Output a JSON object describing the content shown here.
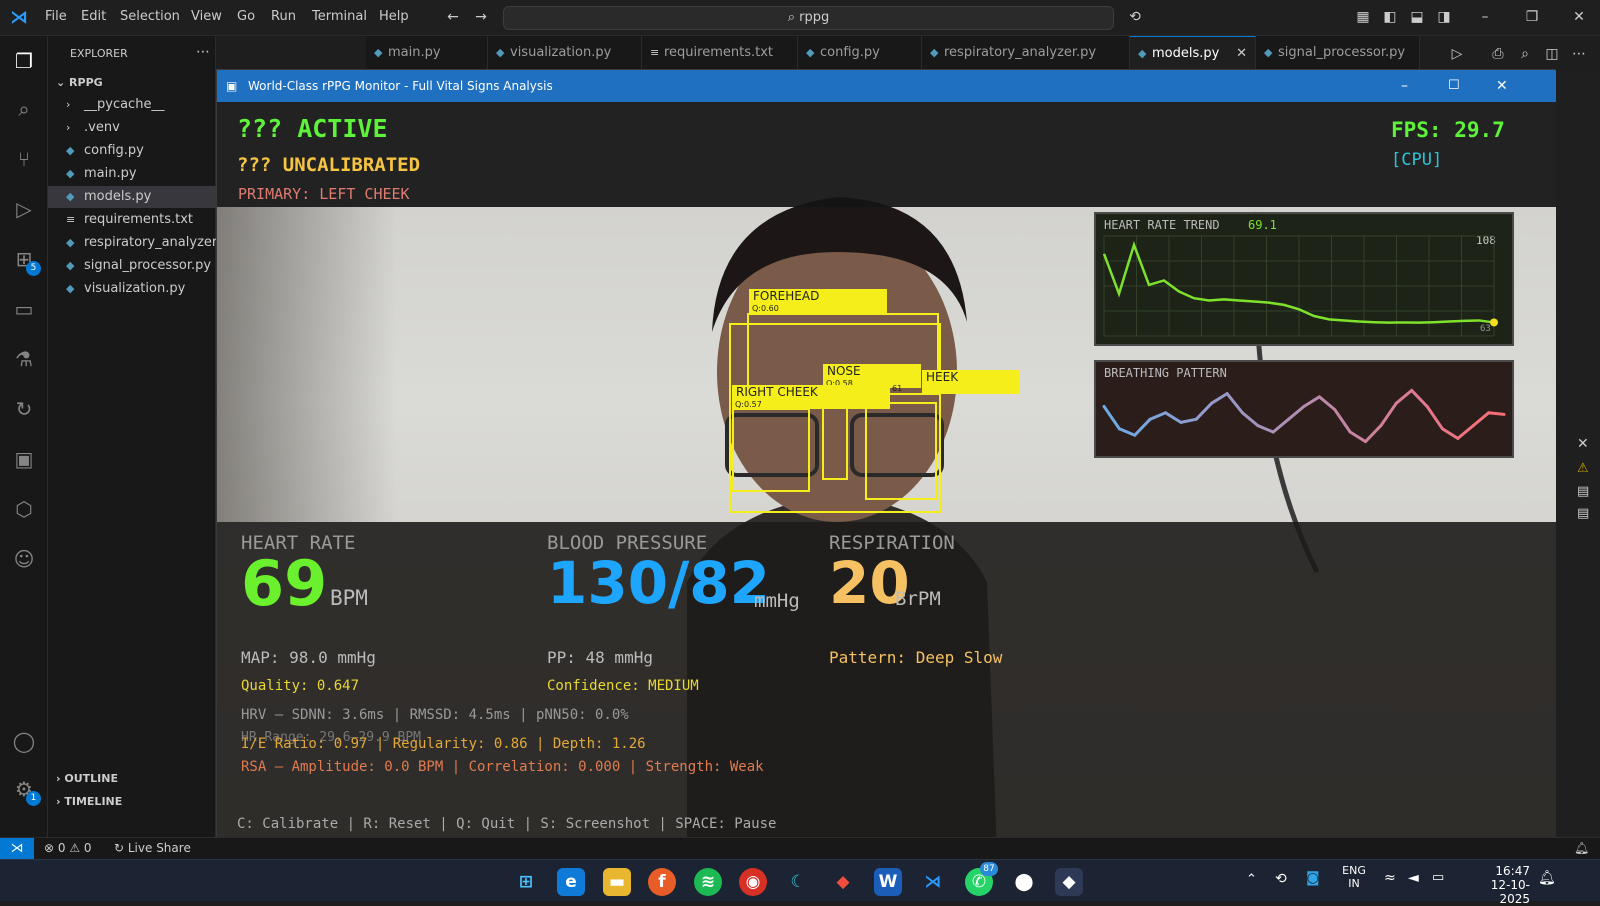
{
  "vscode": {
    "menu": [
      "File",
      "Edit",
      "Selection",
      "View",
      "Go",
      "Run",
      "Terminal",
      "Help"
    ],
    "search": "rppg",
    "explorer_title": "EXPLORER",
    "project": "RPPG",
    "files": [
      "__pycache__",
      ".venv",
      "config.py",
      "main.py",
      "models.py",
      "requirements.txt",
      "respiratory_analyzer.py",
      "signal_processor.py",
      "visualization.py"
    ],
    "tabs": [
      "main.py",
      "visualization.py",
      "requirements.txt",
      "config.py",
      "respiratory_analyzer.py",
      "models.py",
      "signal_processor.py"
    ],
    "active_tab": "models.py",
    "outline": "OUTLINE",
    "timeline": "TIMELINE",
    "status": {
      "errors": "0",
      "warnings": "0",
      "live_share": "Live Share"
    },
    "badges": {
      "extensions": "5",
      "settings": "1"
    }
  },
  "app": {
    "window_title": "World-Class rPPG Monitor - Full Vital Signs Analysis",
    "status_active": "??? ACTIVE",
    "status_calib": "??? UNCALIBRATED",
    "primary": "PRIMARY: LEFT CHEEK",
    "fps": "FPS: 29.7",
    "device": "[CPU]",
    "roi": {
      "forehead": "FOREHEAD",
      "forehead_q": "Q:0.60",
      "nose": "NOSE",
      "nose_q": "Q:0.58",
      "left_cheek": "HEEK",
      "left_q": "61",
      "right_cheek": "RIGHT CHEEK",
      "right_q": "Q:0.57"
    },
    "hr_trend": {
      "title": "HEART RATE TREND",
      "value": "69.1",
      "max": "108",
      "min": "63",
      "color": "#7ee22d"
    },
    "breathing": {
      "title": "BREATHING PATTERN"
    },
    "heart_rate": {
      "label": "HEART RATE",
      "value": "69",
      "unit": "BPM",
      "color": "#6bf02e"
    },
    "blood_pressure": {
      "label": "BLOOD PRESSURE",
      "value": "130/82",
      "unit": "mmHg",
      "color": "#1ea6ff"
    },
    "respiration": {
      "label": "RESPIRATION",
      "value": "20",
      "unit": "BrPM",
      "color": "#f5c163"
    },
    "map": "MAP: 98.0 mmHg",
    "pp": "PP: 48 mmHg",
    "pattern": "Pattern: Deep Slow",
    "quality": "Quality: 0.647",
    "confidence": "Confidence: MEDIUM",
    "hrv": "HRV — SDNN: 3.6ms | RMSSD: 4.5ms | pNN50: 0.0%",
    "hr_range": "HR Range: 29.6–29.9 BPM",
    "ie": "I/E Ratio: 0.97 | Regularity: 0.86 | Depth: 1.26",
    "rsa": "RSA — Amplitude: 0.0 BPM | Correlation: 0.000 | Strength: Weak",
    "controls": "C: Calibrate | R: Reset | Q: Quit | S: Screenshot | SPACE: Pause"
  },
  "chart_data": [
    {
      "type": "line",
      "title": "HEART RATE TREND",
      "ylim": [
        63,
        108
      ],
      "series": [
        {
          "values": [
            100,
            82,
            104,
            86,
            88,
            83,
            80,
            79,
            79.5,
            79,
            78.5,
            78,
            77,
            75,
            72,
            70.5,
            70,
            69.5,
            69.2,
            69,
            69.1,
            69,
            69.2,
            69.5,
            69.8,
            70,
            69.1
          ]
        }
      ]
    },
    {
      "type": "line",
      "title": "BREATHING PATTERN",
      "series": [
        {
          "values": [
            0.3,
            -0.4,
            -0.6,
            -0.1,
            0.1,
            -0.2,
            -0.1,
            0.4,
            0.7,
            0.1,
            -0.3,
            -0.5,
            -0.1,
            0.3,
            0.6,
            0.2,
            -0.5,
            -0.8,
            -0.3,
            0.4,
            0.8,
            0.3,
            -0.4,
            -0.7,
            -0.3,
            0.1,
            0.05
          ]
        }
      ]
    }
  ],
  "clock": {
    "time": "16:47",
    "date": "12-10-2025",
    "lang1": "ENG",
    "lang2": "IN"
  }
}
